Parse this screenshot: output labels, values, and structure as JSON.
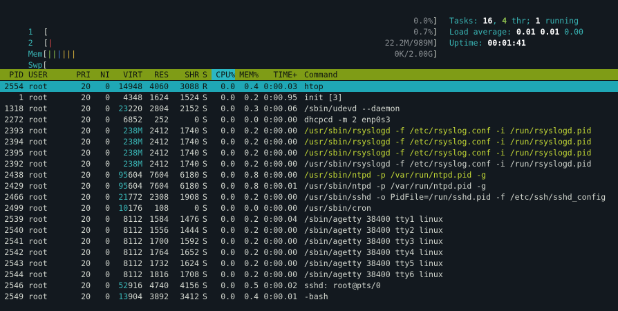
{
  "meters": {
    "cpu1": {
      "label": "1",
      "open": "[",
      "bars": "",
      "value": "0.0%",
      "close": "]"
    },
    "cpu2": {
      "label": "2",
      "open": "[",
      "bars": "|",
      "value": "0.7%",
      "close": "]"
    },
    "mem": {
      "label": "Mem",
      "open": "[",
      "bars": "||||||",
      "value": "22.2M/989M",
      "close": "]"
    },
    "swp": {
      "label": "Swp",
      "open": "[",
      "bars": "",
      "value": "0K/2.00G",
      "close": "]"
    }
  },
  "stats": {
    "tasks_label": "Tasks: ",
    "tasks": "16",
    "sep1": ", ",
    "thr": "4",
    "thr_label": " thr; ",
    "running": "1",
    "running_label": " running",
    "load_label": "Load average: ",
    "load1": "0.01",
    "load5": "0.01",
    "load15": "0.00",
    "uptime_label": "Uptime: ",
    "uptime": "00:01:41"
  },
  "columns": [
    "PID",
    "USER",
    "PRI",
    "NI",
    "VIRT",
    "RES",
    "SHR",
    "S",
    "CPU%",
    "MEM%",
    "TIME+",
    "Command"
  ],
  "processes": [
    {
      "pid": "2554",
      "user": "root",
      "pri": "20",
      "ni": "0",
      "virt": "14948",
      "res": "4060",
      "shr": "3088",
      "s": "R",
      "cpu": "0.0",
      "mem": "0.4",
      "time": "0:00.03",
      "cmd": "htop",
      "thread": false
    },
    {
      "pid": "1",
      "user": "root",
      "pri": "20",
      "ni": "0",
      "virt": "4348",
      "res": "1624",
      "shr": "1524",
      "s": "S",
      "cpu": "0.0",
      "mem": "0.2",
      "time": "0:00.95",
      "cmd": "init [3]",
      "thread": false
    },
    {
      "pid": "1318",
      "user": "root",
      "pri": "20",
      "ni": "0",
      "virt": "23220",
      "res": "2804",
      "shr": "2152",
      "s": "S",
      "cpu": "0.0",
      "mem": "0.3",
      "time": "0:00.06",
      "cmd": "/sbin/udevd --daemon",
      "thread": false
    },
    {
      "pid": "2272",
      "user": "root",
      "pri": "20",
      "ni": "0",
      "virt": "6852",
      "res": "252",
      "shr": "0",
      "s": "S",
      "cpu": "0.0",
      "mem": "0.0",
      "time": "0:00.00",
      "cmd": "dhcpcd -m 2 enp0s3",
      "thread": false
    },
    {
      "pid": "2393",
      "user": "root",
      "pri": "20",
      "ni": "0",
      "virt": "238M",
      "res": "2412",
      "shr": "1740",
      "s": "S",
      "cpu": "0.0",
      "mem": "0.2",
      "time": "0:00.00",
      "cmd": "/usr/sbin/rsyslogd -f /etc/rsyslog.conf -i /run/rsyslogd.pid",
      "thread": true
    },
    {
      "pid": "2394",
      "user": "root",
      "pri": "20",
      "ni": "0",
      "virt": "238M",
      "res": "2412",
      "shr": "1740",
      "s": "S",
      "cpu": "0.0",
      "mem": "0.2",
      "time": "0:00.00",
      "cmd": "/usr/sbin/rsyslogd -f /etc/rsyslog.conf -i /run/rsyslogd.pid",
      "thread": true
    },
    {
      "pid": "2395",
      "user": "root",
      "pri": "20",
      "ni": "0",
      "virt": "238M",
      "res": "2412",
      "shr": "1740",
      "s": "S",
      "cpu": "0.0",
      "mem": "0.2",
      "time": "0:00.00",
      "cmd": "/usr/sbin/rsyslogd -f /etc/rsyslog.conf -i /run/rsyslogd.pid",
      "thread": true
    },
    {
      "pid": "2392",
      "user": "root",
      "pri": "20",
      "ni": "0",
      "virt": "238M",
      "res": "2412",
      "shr": "1740",
      "s": "S",
      "cpu": "0.0",
      "mem": "0.2",
      "time": "0:00.00",
      "cmd": "/usr/sbin/rsyslogd -f /etc/rsyslog.conf -i /run/rsyslogd.pid",
      "thread": false
    },
    {
      "pid": "2438",
      "user": "root",
      "pri": "20",
      "ni": "0",
      "virt": "95604",
      "res": "7604",
      "shr": "6180",
      "s": "S",
      "cpu": "0.0",
      "mem": "0.8",
      "time": "0:00.00",
      "cmd": "/usr/sbin/ntpd -p /var/run/ntpd.pid -g",
      "thread": true
    },
    {
      "pid": "2429",
      "user": "root",
      "pri": "20",
      "ni": "0",
      "virt": "95604",
      "res": "7604",
      "shr": "6180",
      "s": "S",
      "cpu": "0.0",
      "mem": "0.8",
      "time": "0:00.01",
      "cmd": "/usr/sbin/ntpd -p /var/run/ntpd.pid -g",
      "thread": false
    },
    {
      "pid": "2466",
      "user": "root",
      "pri": "20",
      "ni": "0",
      "virt": "21772",
      "res": "2308",
      "shr": "1908",
      "s": "S",
      "cpu": "0.0",
      "mem": "0.2",
      "time": "0:00.00",
      "cmd": "/usr/sbin/sshd -o PidFile=/run/sshd.pid -f /etc/ssh/sshd_config",
      "thread": false
    },
    {
      "pid": "2499",
      "user": "root",
      "pri": "20",
      "ni": "0",
      "virt": "10176",
      "res": "108",
      "shr": "0",
      "s": "S",
      "cpu": "0.0",
      "mem": "0.0",
      "time": "0:00.00",
      "cmd": "/usr/sbin/cron",
      "thread": false
    },
    {
      "pid": "2539",
      "user": "root",
      "pri": "20",
      "ni": "0",
      "virt": "8112",
      "res": "1584",
      "shr": "1476",
      "s": "S",
      "cpu": "0.0",
      "mem": "0.2",
      "time": "0:00.04",
      "cmd": "/sbin/agetty 38400 tty1 linux",
      "thread": false
    },
    {
      "pid": "2540",
      "user": "root",
      "pri": "20",
      "ni": "0",
      "virt": "8112",
      "res": "1556",
      "shr": "1444",
      "s": "S",
      "cpu": "0.0",
      "mem": "0.2",
      "time": "0:00.00",
      "cmd": "/sbin/agetty 38400 tty2 linux",
      "thread": false
    },
    {
      "pid": "2541",
      "user": "root",
      "pri": "20",
      "ni": "0",
      "virt": "8112",
      "res": "1700",
      "shr": "1592",
      "s": "S",
      "cpu": "0.0",
      "mem": "0.2",
      "time": "0:00.00",
      "cmd": "/sbin/agetty 38400 tty3 linux",
      "thread": false
    },
    {
      "pid": "2542",
      "user": "root",
      "pri": "20",
      "ni": "0",
      "virt": "8112",
      "res": "1764",
      "shr": "1652",
      "s": "S",
      "cpu": "0.0",
      "mem": "0.2",
      "time": "0:00.00",
      "cmd": "/sbin/agetty 38400 tty4 linux",
      "thread": false
    },
    {
      "pid": "2543",
      "user": "root",
      "pri": "20",
      "ni": "0",
      "virt": "8112",
      "res": "1732",
      "shr": "1624",
      "s": "S",
      "cpu": "0.0",
      "mem": "0.2",
      "time": "0:00.00",
      "cmd": "/sbin/agetty 38400 tty5 linux",
      "thread": false
    },
    {
      "pid": "2544",
      "user": "root",
      "pri": "20",
      "ni": "0",
      "virt": "8112",
      "res": "1816",
      "shr": "1708",
      "s": "S",
      "cpu": "0.0",
      "mem": "0.2",
      "time": "0:00.00",
      "cmd": "/sbin/agetty 38400 tty6 linux",
      "thread": false
    },
    {
      "pid": "2546",
      "user": "root",
      "pri": "20",
      "ni": "0",
      "virt": "52916",
      "res": "4740",
      "shr": "4156",
      "s": "S",
      "cpu": "0.0",
      "mem": "0.5",
      "time": "0:00.02",
      "cmd": "sshd: root@pts/0",
      "thread": false
    },
    {
      "pid": "2549",
      "user": "root",
      "pri": "20",
      "ni": "0",
      "virt": "13904",
      "res": "3892",
      "shr": "3412",
      "s": "S",
      "cpu": "0.0",
      "mem": "0.4",
      "time": "0:00.01",
      "cmd": "-bash",
      "thread": false
    }
  ],
  "colors": {
    "selected_row": "#1fa7b5",
    "header_bar": "#7f9c16",
    "sort_column": "#2bb7c2",
    "thread_text": "#c3d836",
    "label_cyan": "#39b5b5"
  }
}
